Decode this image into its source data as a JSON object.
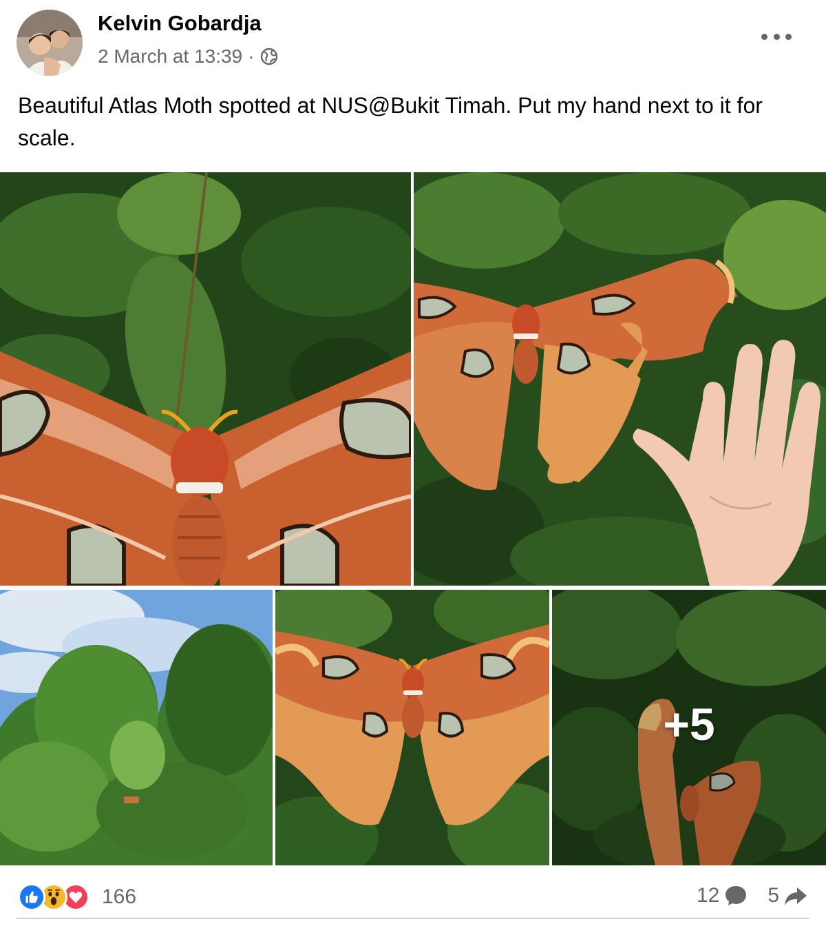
{
  "post": {
    "author": "Kelvin Gobardja",
    "timestamp": "2 March at 13:39",
    "separator": "·",
    "privacy_icon": "globe-icon",
    "menu_icon": "more-options-icon",
    "caption": "Beautiful Atlas Moth spotted at NUS@Bukit Timah. Put my hand next to it for scale."
  },
  "photos": {
    "more_count": "+5"
  },
  "footer": {
    "reaction_icons": [
      "like-icon",
      "wow-icon",
      "love-icon"
    ],
    "reaction_count": "166",
    "comment_count": "12",
    "comment_icon": "comment-icon",
    "share_count": "5",
    "share_icon": "share-icon"
  },
  "colors": {
    "like": "#1877f2",
    "love": "#f33e58",
    "wow": "#f7b928",
    "secondary_text": "#65676b",
    "moth_orange": "#d2693a",
    "foliage": "#2f5a1f"
  }
}
